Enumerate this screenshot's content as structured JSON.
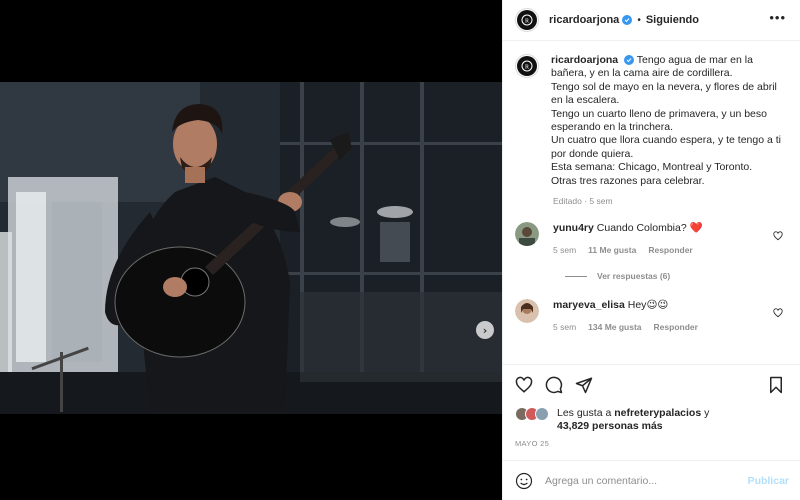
{
  "post": {
    "username": "ricardoarjona",
    "follow_label": "Siguiendo",
    "separator": "•",
    "more_label": "•••",
    "caption": [
      "Tengo agua de mar en la bañera, y en la cama aire de cordillera.",
      "Tengo sol de mayo en la nevera, y flores de abril en la escalera.",
      "Tengo un cuarto lleno de primavera, y un beso esperando en la trinchera.",
      "Un cuatro que llora cuando espera, y te tengo a ti por donde quiera.",
      "Esta semana: Chicago, Montreal y Toronto.",
      "Otras tres razones para celebrar."
    ],
    "caption_meta": "Editado · 5 sem"
  },
  "comments": [
    {
      "username": "yunu4ry",
      "text": "Cuando Colombia?",
      "emoji": "❤️",
      "time": "5 sem",
      "likes": "11 Me gusta",
      "reply_label": "Responder",
      "view_replies": "Ver respuestas (6)"
    },
    {
      "username": "maryeva_elisa",
      "text": "Hey",
      "emoji": "😉😉",
      "time": "5 sem",
      "likes": "134 Me gusta",
      "reply_label": "Responder"
    }
  ],
  "likes": {
    "prefix": "Les gusta a",
    "user": "nefreterypalacios",
    "conjunction": "y",
    "count": "43,829 personas más"
  },
  "date": "MAYO 25",
  "add_comment": {
    "placeholder": "Agrega un comentario...",
    "publish_label": "Publicar"
  },
  "carousel": {
    "slide_count": 4,
    "active_index": 0
  },
  "colors": {
    "verified": "#3897f0",
    "link_disabled": "#b2dffc",
    "heart_red": "#ed4956",
    "muted": "#8e8e8e"
  },
  "icons": [
    "verified-badge-icon",
    "more-options-icon",
    "next-arrow-icon",
    "heart-icon",
    "comment-icon",
    "share-icon",
    "bookmark-icon",
    "emoji-icon"
  ]
}
